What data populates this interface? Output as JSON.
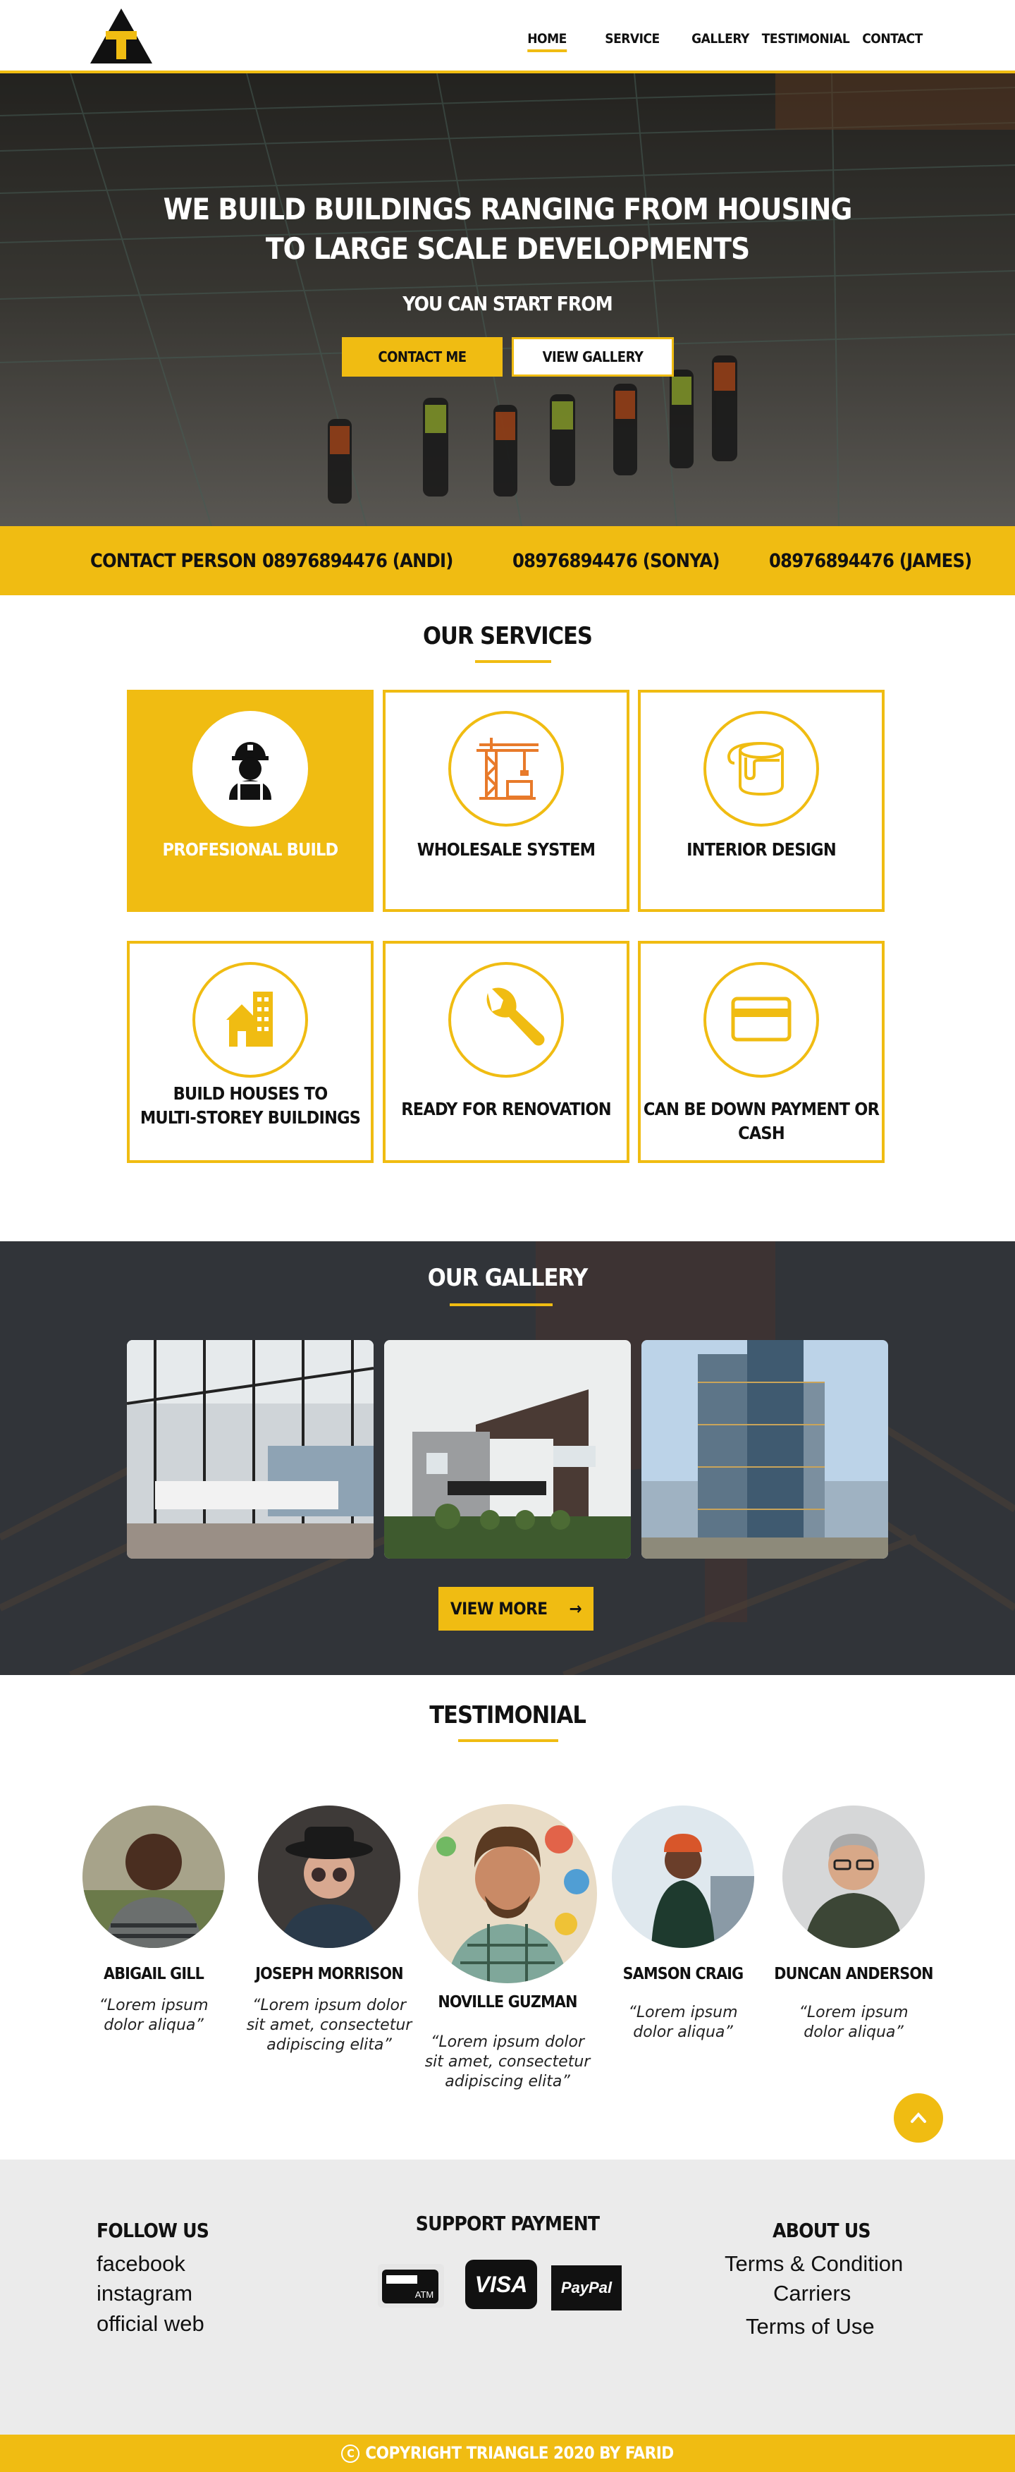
{
  "nav": {
    "items": [
      "HOME",
      "SERVICE",
      "GALLERY",
      "TESTIMONIAL",
      "CONTACT"
    ]
  },
  "hero": {
    "title_line1": "WE BUILD BUILDINGS RANGING FROM HOUSING",
    "title_line2": "TO LARGE SCALE DEVELOPMENTS",
    "subtitle": "YOU CAN START FROM",
    "contact_button": "CONTACT ME",
    "gallery_button": "VIEW GALLERY"
  },
  "contact": {
    "label": "CONTACT PERSON",
    "phones": [
      "08976894476 (ANDI)",
      "08976894476 (SONYA)",
      "08976894476 (JAMES)"
    ]
  },
  "services": {
    "title": "OUR SERVICES",
    "items": [
      {
        "label": "PROFESIONAL BUILD",
        "icon": "worker-icon"
      },
      {
        "label": "WHOLESALE SYSTEM",
        "icon": "crane-icon"
      },
      {
        "label": "INTERIOR DESIGN",
        "icon": "paint-bucket-icon"
      },
      {
        "label_line1": "BUILD HOUSES TO",
        "label_line2": "MULTI-STOREY BUILDINGS",
        "icon": "buildings-icon"
      },
      {
        "label": "READY FOR RENOVATION",
        "icon": "wrench-icon"
      },
      {
        "label": "CAN BE DOWN PAYMENT OR CASH",
        "icon": "credit-card-icon"
      }
    ]
  },
  "gallery": {
    "title": "OUR GALLERY",
    "view_more": "VIEW MORE"
  },
  "testimonial": {
    "title": "TESTIMONIAL",
    "people": [
      {
        "name": "ABIGAIL GILL",
        "quote_l1": "“Lorem ipsum",
        "quote_l2": "dolor aliqua”",
        "quote_l3": ""
      },
      {
        "name": "JOSEPH MORRISON",
        "quote_l1": "“Lorem ipsum dolor",
        "quote_l2": "sit amet, consectetur",
        "quote_l3": "adipiscing elita”"
      },
      {
        "name": "NOVILLE GUZMAN",
        "quote_l1": "“Lorem ipsum dolor",
        "quote_l2": "sit amet, consectetur",
        "quote_l3": "adipiscing elita”"
      },
      {
        "name": "SAMSON CRAIG",
        "quote_l1": "“Lorem ipsum",
        "quote_l2": "dolor aliqua”",
        "quote_l3": ""
      },
      {
        "name": "DUNCAN ANDERSON",
        "quote_l1": "“Lorem ipsum",
        "quote_l2": "dolor aliqua”",
        "quote_l3": ""
      }
    ]
  },
  "footer": {
    "follow_title": "FOLLOW US",
    "follow_links": [
      "facebook",
      "instagram",
      "official web"
    ],
    "payment_title": "SUPPORT PAYMENT",
    "payment": {
      "atm": "ATM",
      "visa": "VISA",
      "paypal": "PayPal"
    },
    "about_title": "ABOUT US",
    "about_links": [
      "Terms & Condition",
      "Carriers",
      "Terms of Use"
    ],
    "copyright": "COPYRIGHT TRIANGLE 2020 BY FARID"
  },
  "colors": {
    "accent": "#f0bc12"
  }
}
